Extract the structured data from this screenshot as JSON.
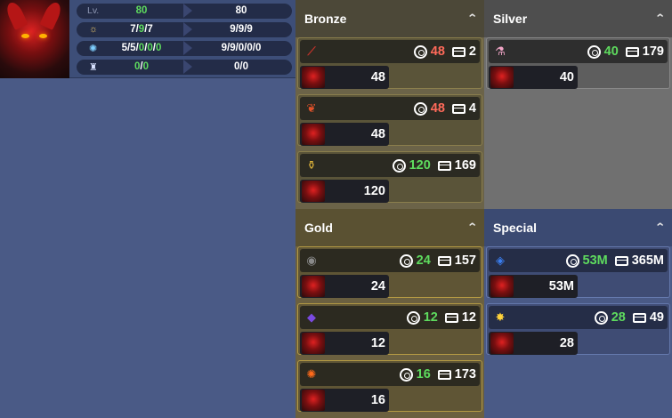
{
  "character": {
    "stats": [
      {
        "label": "Lv.",
        "icon": "",
        "current": [
          {
            "t": "80",
            "c": "g"
          }
        ],
        "target": "80"
      },
      {
        "label": "",
        "icon": "sun-icon",
        "current": [
          {
            "t": "7/",
            "c": "w"
          },
          {
            "t": "9",
            "c": "g"
          },
          {
            "t": "/7",
            "c": "w"
          }
        ],
        "target": "9/9/9"
      },
      {
        "label": "",
        "icon": "star-icon",
        "current": [
          {
            "t": "5/5/",
            "c": "w"
          },
          {
            "t": "0",
            "c": "g"
          },
          {
            "t": "/",
            "c": "w"
          },
          {
            "t": "0",
            "c": "g"
          },
          {
            "t": "/",
            "c": "w"
          },
          {
            "t": "0",
            "c": "g"
          }
        ],
        "target": "9/9/0/0/0"
      },
      {
        "label": "",
        "icon": "flag-icon",
        "current": [
          {
            "t": "0",
            "c": "g"
          },
          {
            "t": "/",
            "c": "w"
          },
          {
            "t": "0",
            "c": "g"
          }
        ],
        "target": "0/0"
      }
    ]
  },
  "panels": {
    "bronze": {
      "title": "Bronze",
      "items": [
        {
          "icon": "red-stick-icon",
          "glyph": "⟋",
          "glyph_color": "#c0322a",
          "target": "48",
          "target_color": "red",
          "stock": "2",
          "count": "48"
        },
        {
          "icon": "red-ribbon-icon",
          "glyph": "❦",
          "glyph_color": "#e0522a",
          "target": "48",
          "target_color": "red",
          "stock": "4",
          "count": "48"
        },
        {
          "icon": "gold-bell-icon",
          "glyph": "⚱",
          "glyph_color": "#e0b43a",
          "target": "120",
          "target_color": "grn",
          "stock": "169",
          "count": "120"
        }
      ]
    },
    "silver": {
      "title": "Silver",
      "items": [
        {
          "icon": "pink-potion-icon",
          "glyph": "⚗",
          "glyph_color": "#f3a6c8",
          "target": "40",
          "target_color": "grn",
          "stock": "179",
          "count": "40"
        }
      ]
    },
    "gold": {
      "title": "Gold",
      "items": [
        {
          "icon": "dark-orb-icon",
          "glyph": "◉",
          "glyph_color": "#8a8a8a",
          "target": "24",
          "target_color": "grn",
          "stock": "157",
          "count": "24"
        },
        {
          "icon": "purple-gem-icon",
          "glyph": "◆",
          "glyph_color": "#7a4ae0",
          "target": "12",
          "target_color": "grn",
          "stock": "12",
          "count": "12"
        },
        {
          "icon": "fire-flower-icon",
          "glyph": "✺",
          "glyph_color": "#ff6a1a",
          "target": "16",
          "target_color": "grn",
          "stock": "173",
          "count": "16"
        }
      ]
    },
    "special": {
      "title": "Special",
      "items": [
        {
          "icon": "blue-crystal-icon",
          "glyph": "◈",
          "glyph_color": "#3a7ef0",
          "target": "53M",
          "target_color": "grn",
          "stock": "365M",
          "count": "53M"
        },
        {
          "icon": "gold-burst-icon",
          "glyph": "✸",
          "glyph_color": "#ffd23a",
          "target": "28",
          "target_color": "grn",
          "stock": "49",
          "count": "28"
        }
      ]
    }
  },
  "ui": {
    "collapse_glyph": "ˇ"
  }
}
